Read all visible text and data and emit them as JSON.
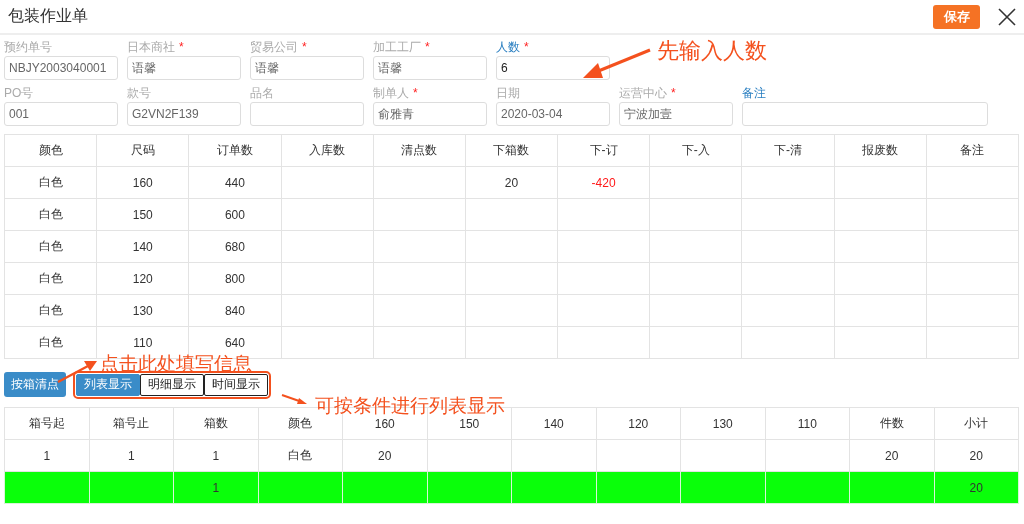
{
  "window": {
    "title": "包装作业单",
    "save_button": "保存"
  },
  "form": {
    "required_mark": "*",
    "rows": [
      [
        {
          "label": "预约单号",
          "value": "NBJY2003040001",
          "required": false,
          "editable": false
        },
        {
          "label": "日本商社",
          "value": "语馨",
          "required": true,
          "editable": false
        },
        {
          "label": "贸易公司",
          "value": "语馨",
          "required": true,
          "editable": false
        },
        {
          "label": "加工工厂",
          "value": "语馨",
          "required": true,
          "editable": false
        },
        {
          "label": "人数",
          "value": "6",
          "required": true,
          "editable": true
        }
      ],
      [
        {
          "label": "PO号",
          "value": "001",
          "required": false,
          "editable": false
        },
        {
          "label": "款号",
          "value": "G2VN2F139",
          "required": false,
          "editable": false
        },
        {
          "label": "品名",
          "required": false,
          "editable": false
        },
        {
          "label": "制单人",
          "value": "俞雅青",
          "required": true,
          "editable": false
        },
        {
          "label": "日期",
          "value": "2020-03-04",
          "required": false,
          "editable": false
        },
        {
          "label": "运营中心",
          "value": "宁波加壹",
          "required": true,
          "editable": false
        },
        {
          "label": "备注",
          "required": false,
          "editable": true,
          "wide": true
        }
      ]
    ]
  },
  "order_table": {
    "columns": [
      "颜色",
      "尺码",
      "订单数",
      "入库数",
      "清点数",
      "下箱数",
      "下-订",
      "下-入",
      "下-清",
      "报废数",
      "备注"
    ],
    "rows": [
      {
        "cells": [
          "白色",
          "160",
          "440",
          null,
          null,
          "20",
          {
            "text": "-420",
            "negative": true
          },
          null,
          null,
          null,
          null
        ]
      },
      {
        "cells": [
          "白色",
          "150",
          "600",
          null,
          null,
          null,
          null,
          null,
          null,
          null,
          null
        ]
      },
      {
        "cells": [
          "白色",
          "140",
          "680",
          null,
          null,
          null,
          null,
          null,
          null,
          null,
          null
        ]
      },
      {
        "cells": [
          "白色",
          "120",
          "800",
          null,
          null,
          null,
          null,
          null,
          null,
          null,
          null
        ]
      },
      {
        "cells": [
          "白色",
          "130",
          "840",
          null,
          null,
          null,
          null,
          null,
          null,
          null,
          null
        ]
      },
      {
        "cells": [
          "白色",
          "110",
          "640",
          null,
          null,
          null,
          null,
          null,
          null,
          null,
          null
        ]
      }
    ]
  },
  "box_count_button": "按箱清点",
  "view_tabs": {
    "outlined": true,
    "tabs": [
      {
        "label": "列表显示",
        "selected": true
      },
      {
        "label": "明细显示",
        "selected": false
      },
      {
        "label": "时间显示",
        "selected": false
      }
    ]
  },
  "box_table": {
    "columns": [
      "箱号起",
      "箱号止",
      "箱数",
      "颜色",
      "160",
      "150",
      "140",
      "120",
      "130",
      "110",
      "件数",
      "小计"
    ],
    "rows": [
      {
        "total": false,
        "cells": [
          "1",
          "1",
          "1",
          "白色",
          "20",
          null,
          null,
          null,
          null,
          null,
          "20",
          "20"
        ]
      },
      {
        "total": true,
        "cells": [
          null,
          null,
          "1",
          null,
          null,
          null,
          null,
          null,
          null,
          null,
          null,
          "20"
        ]
      }
    ]
  },
  "annotations": [
    {
      "text": "先输入人数",
      "kind": "top"
    },
    {
      "text": "点击此处填写信息",
      "kind": "left"
    },
    {
      "text": "可按条件进行列表显示",
      "kind": "bottom"
    }
  ]
}
